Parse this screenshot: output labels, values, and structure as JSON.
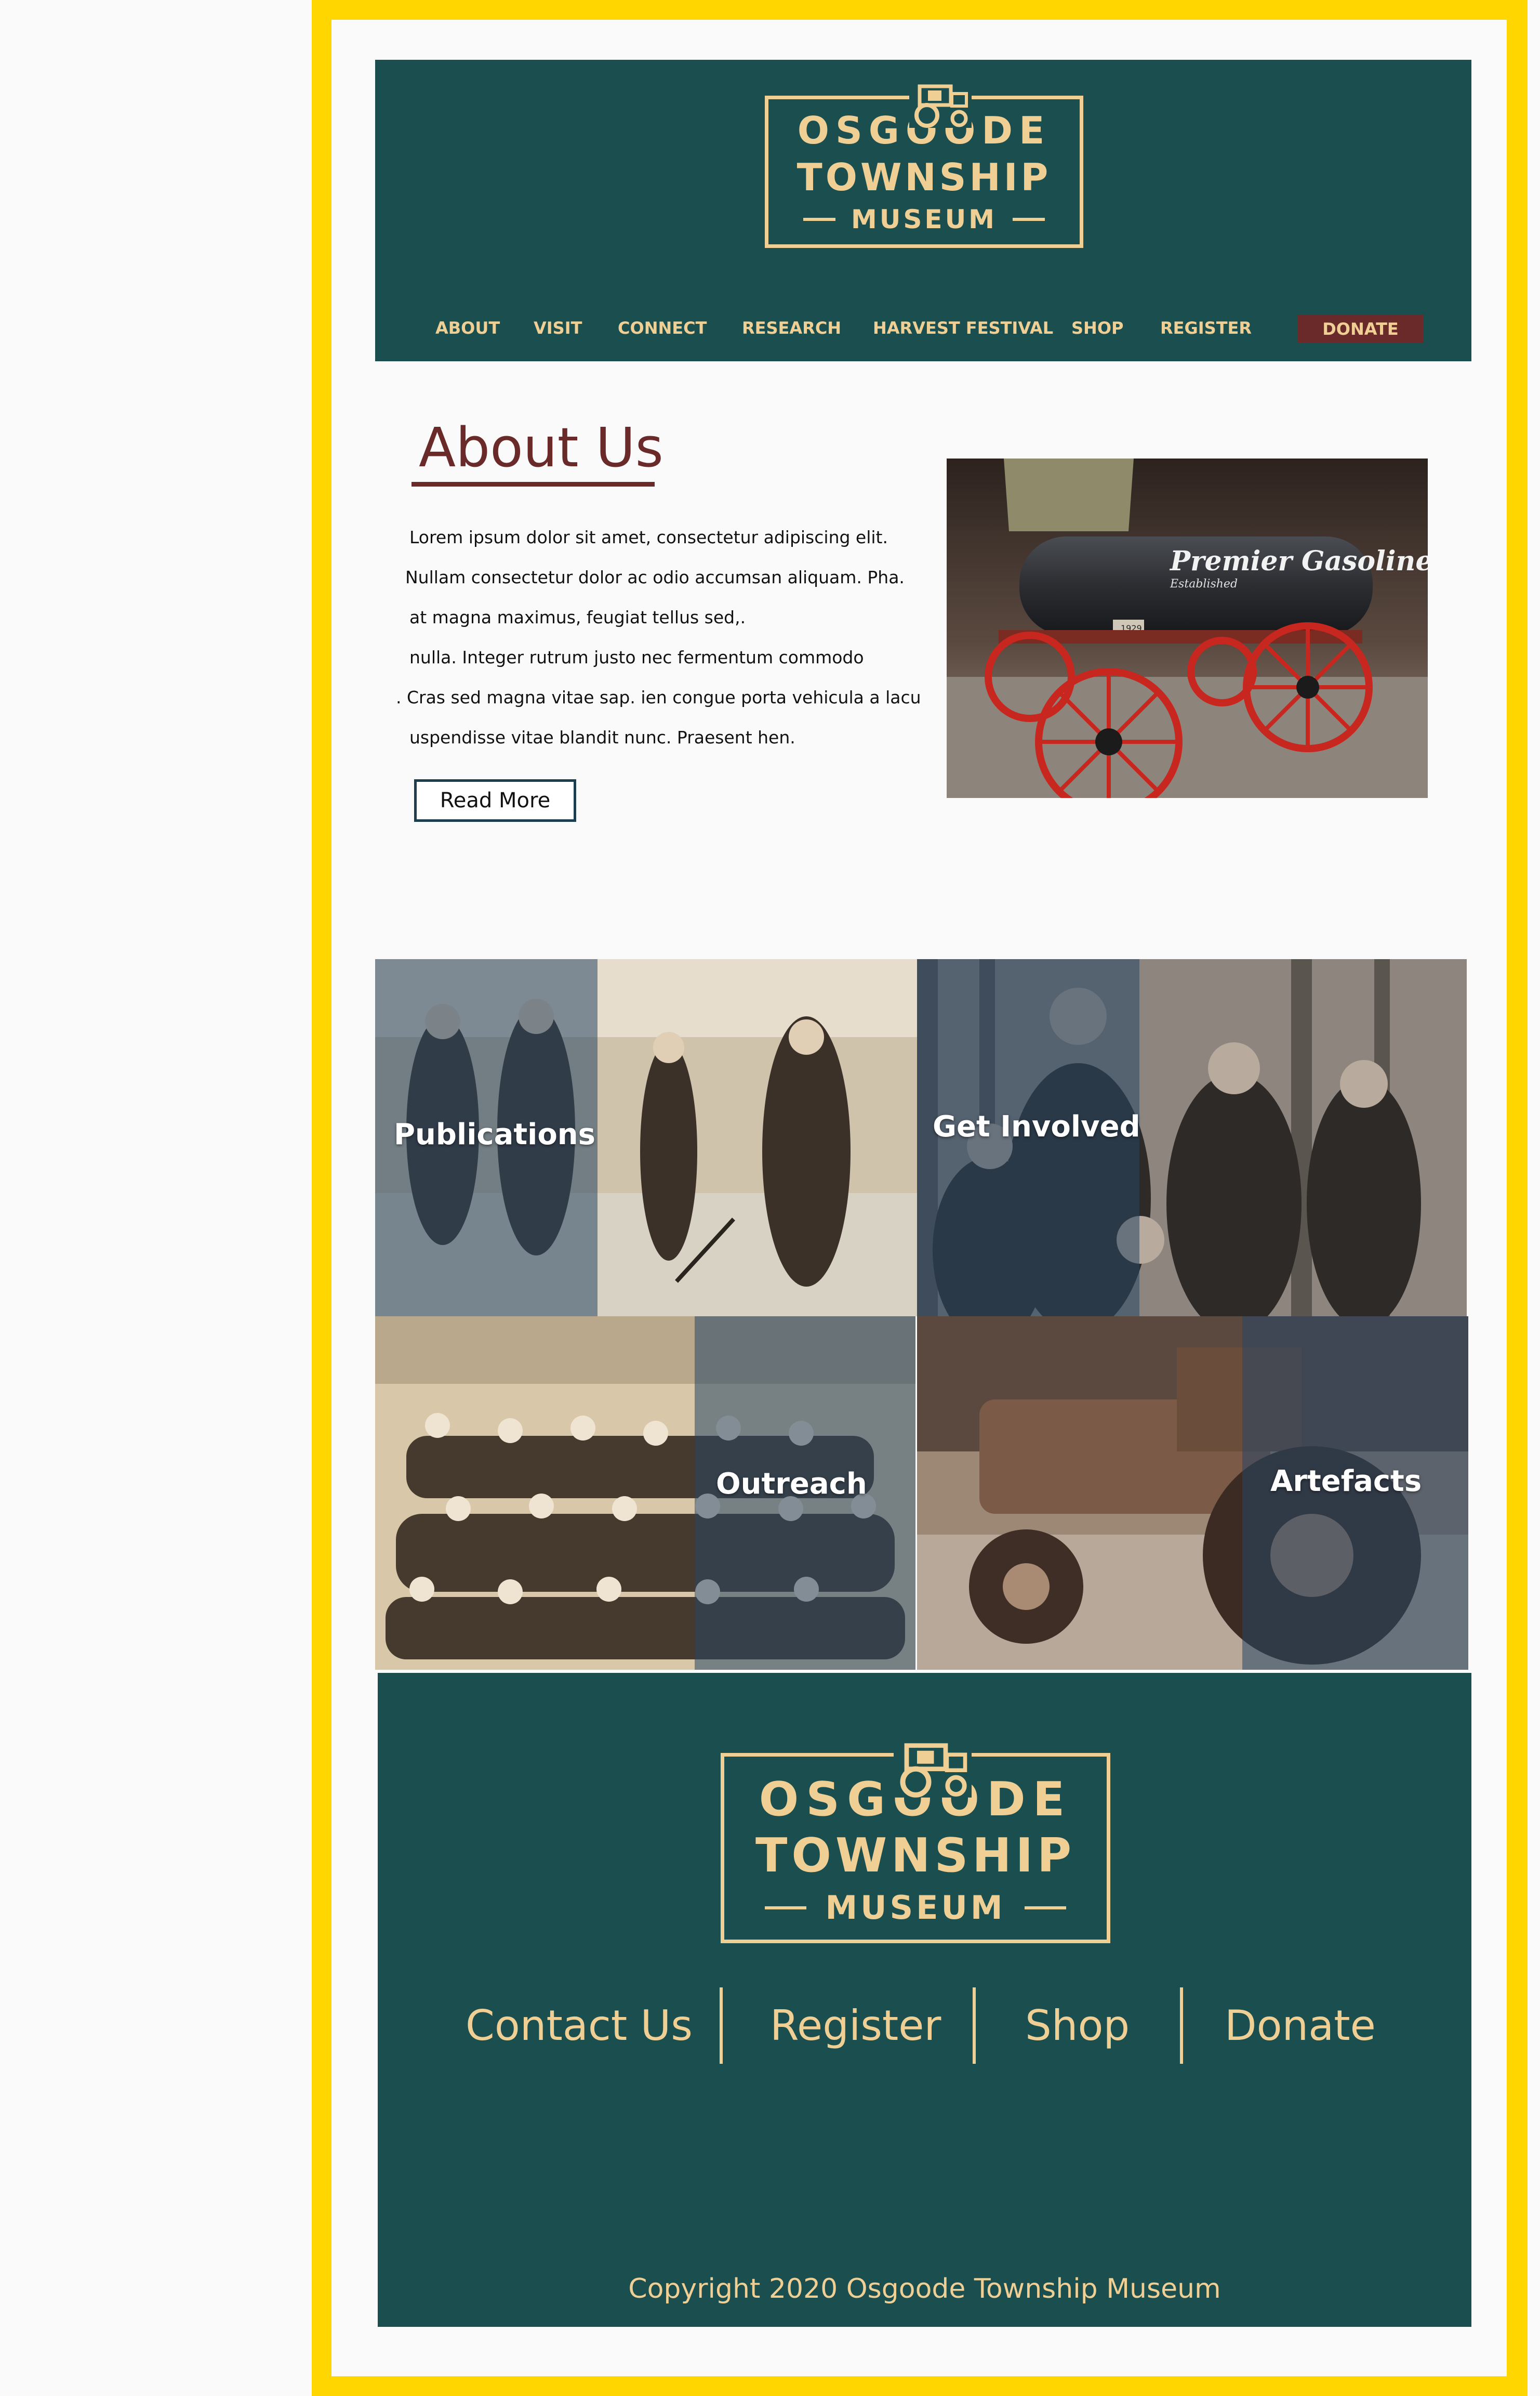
{
  "brand": {
    "line1": "OSGOODE",
    "line2": "TOWNSHIP",
    "line3": "MUSEUM",
    "colors": {
      "teal": "#1b4f4f",
      "gold": "#f0cf95",
      "maroon": "#6b2a2a",
      "frame": "#ffd600"
    }
  },
  "nav": {
    "items": [
      {
        "label": "ABOUT"
      },
      {
        "label": "VISIT"
      },
      {
        "label": "CONNECT"
      },
      {
        "label": "RESEARCH"
      },
      {
        "label": "HARVEST FESTIVAL"
      },
      {
        "label": "SHOP"
      },
      {
        "label": "REGISTER"
      }
    ],
    "donate_label": "DONATE"
  },
  "about": {
    "title": "About Us",
    "lines": [
      "Lorem ipsum dolor sit amet, consectetur adipiscing elit.",
      "Nullam consectetur dolor ac odio accumsan aliquam. Pha.",
      "at magna maximus, feugiat tellus sed,.",
      "nulla. Integer rutrum justo nec fermentum commodo",
      ". Cras sed magna vitae sap. ien congue porta vehicula a lacu",
      "uspendisse vitae blandit nunc. Praesent hen."
    ],
    "read_more_label": "Read More",
    "image": {
      "sign_text": "Premier Gasoline",
      "sign_sub": "Established",
      "plate_text": "1929"
    }
  },
  "tiles": [
    {
      "label": "Publications",
      "icon": "skating-women-photo"
    },
    {
      "label": "Get Involved",
      "icon": "farmers-photo"
    },
    {
      "label": "Outreach",
      "icon": "group-photo"
    },
    {
      "label": "Artefacts",
      "icon": "tractor-photo"
    }
  ],
  "footer": {
    "links": [
      {
        "label": "Contact Us"
      },
      {
        "label": "Register"
      },
      {
        "label": "Shop"
      },
      {
        "label": "Donate"
      }
    ],
    "copyright": "Copyright 2020 Osgoode Township Museum"
  }
}
